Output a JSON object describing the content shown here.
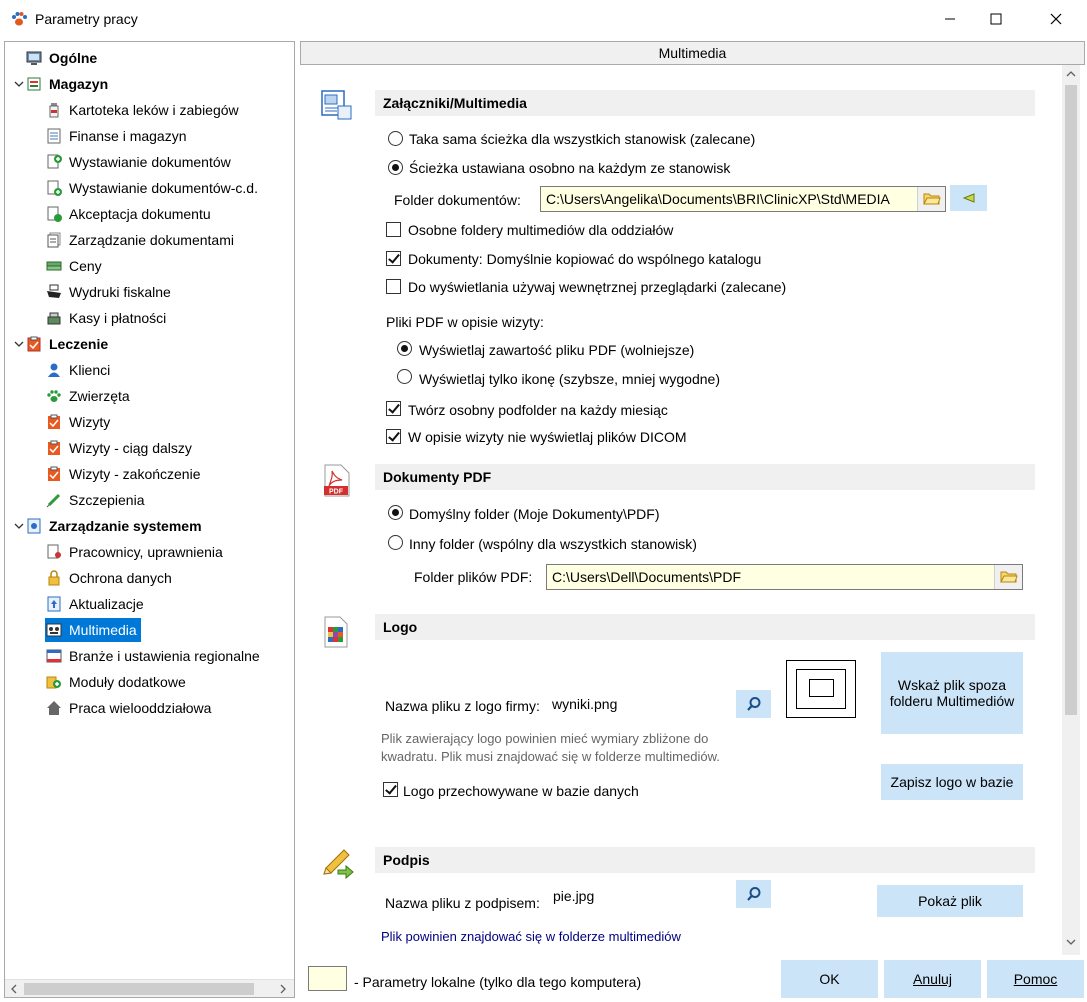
{
  "window": {
    "title": "Parametry pracy"
  },
  "tree": {
    "items": [
      {
        "label": "Ogólne",
        "icon": "monitor-icon",
        "bold": true
      },
      {
        "label": "Magazyn",
        "icon": "warehouse-icon",
        "bold": true
      },
      {
        "label": "Kartoteka leków i zabiegów",
        "icon": "bottle-icon"
      },
      {
        "label": "Finanse i magazyn",
        "icon": "list-icon"
      },
      {
        "label": "Wystawianie dokumentów",
        "icon": "document-add-icon"
      },
      {
        "label": "Wystawianie dokumentów-c.d.",
        "icon": "document-add-icon"
      },
      {
        "label": "Akceptacja dokumentu",
        "icon": "document-check-icon"
      },
      {
        "label": "Zarządzanie dokumentami",
        "icon": "documents-icon"
      },
      {
        "label": "Ceny",
        "icon": "money-icon"
      },
      {
        "label": "Wydruki fiskalne",
        "icon": "printer-icon"
      },
      {
        "label": "Kasy i płatności",
        "icon": "cash-register-icon"
      },
      {
        "label": "Leczenie",
        "icon": "clipboard-icon",
        "bold": true
      },
      {
        "label": "Klienci",
        "icon": "person-icon"
      },
      {
        "label": "Zwierzęta",
        "icon": "paw-icon"
      },
      {
        "label": "Wizyty",
        "icon": "clipboard-icon"
      },
      {
        "label": "Wizyty - ciąg dalszy",
        "icon": "clipboard-icon"
      },
      {
        "label": "Wizyty - zakończenie",
        "icon": "clipboard-icon"
      },
      {
        "label": "Szczepienia",
        "icon": "syringe-icon"
      },
      {
        "label": "Zarządzanie systemem",
        "icon": "system-icon",
        "bold": true
      },
      {
        "label": "Pracownicy, uprawnienia",
        "icon": "users-icon"
      },
      {
        "label": "Ochrona danych",
        "icon": "lock-icon"
      },
      {
        "label": "Aktualizacje",
        "icon": "update-icon"
      },
      {
        "label": "Multimedia",
        "icon": "multimedia-icon",
        "selected": true
      },
      {
        "label": "Branże i ustawienia regionalne",
        "icon": "region-icon"
      },
      {
        "label": "Moduły dodatkowe",
        "icon": "modules-icon"
      },
      {
        "label": "Praca wielooddziałowa",
        "icon": "house-icon"
      }
    ]
  },
  "panel": {
    "header": "Multimedia",
    "attachments": {
      "title": "Załączniki/Multimedia",
      "radio_same_path": "Taka sama ścieżka dla wszystkich stanowisk (zalecane)",
      "radio_separate_path": "Ścieżka ustawiana osobno na każdym ze stanowisk",
      "folder_label": "Folder dokumentów:",
      "folder_value": "C:\\Users\\Angelika\\Documents\\BRI\\ClinicXP\\Std\\MEDIA",
      "chk_separate_folders": "Osobne foldery multimediów dla oddziałów",
      "chk_copy_docs": "Dokumenty: Domyślnie kopiować do wspólnego katalogu",
      "chk_internal_browser": "Do wyświetlania używaj wewnętrznej przeglądarki (zalecane)",
      "pdf_label": "Pliki PDF w opisie wizyty:",
      "radio_pdf_content": "Wyświetlaj zawartość pliku PDF (wolniejsze)",
      "radio_pdf_icon": "Wyświetlaj tylko ikonę (szybsze, mniej wygodne)",
      "chk_subfolder": "Twórz osobny podfolder na każdy miesiąc",
      "chk_no_dicom": "W opisie wizyty nie wyświetlaj plików DICOM"
    },
    "pdf_docs": {
      "title": "Dokumenty PDF",
      "radio_default": "Domyślny folder (Moje Dokumenty\\PDF)",
      "radio_other": "Inny folder (wspólny dla wszystkich stanowisk)",
      "folder_label": "Folder plików PDF:",
      "folder_value": "C:\\Users\\Dell\\Documents\\PDF"
    },
    "logo": {
      "title": "Logo",
      "file_label": "Nazwa pliku z logo firmy:",
      "file_value": "wyniki.png",
      "hint_line1": "Plik zawierający logo powinien mieć wymiary zbliżone do",
      "hint_line2": "kwadratu. Plik musi znajdować się w folderze multimediów.",
      "btn_choose_line1": "Wskaż plik spoza",
      "btn_choose_line2": "folderu Multimediów",
      "btn_save": "Zapisz logo w bazie",
      "chk_db": "Logo przechowywane w bazie danych"
    },
    "signature": {
      "title": "Podpis",
      "file_label": "Nazwa pliku z podpisem:",
      "file_value": "pie.jpg",
      "btn_show": "Pokaż plik",
      "hint": "Plik powinien znajdować się w folderze multimediów"
    }
  },
  "footer": {
    "legend": "- Parametry lokalne (tylko dla tego komputera)",
    "ok": "OK",
    "cancel": "Anuluj",
    "help": "Pomoc"
  },
  "colors": {
    "selection": "#0078d7",
    "button": "#cce4f7",
    "local_field": "#ffffe1",
    "section_bar": "#f0f0f0",
    "hint_blue": "#000080"
  }
}
